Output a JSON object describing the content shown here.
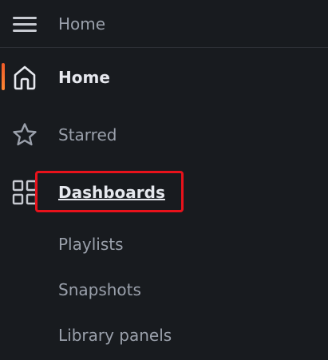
{
  "header": {
    "breadcrumb": "Home",
    "menu_icon": "hamburger-menu-icon"
  },
  "nav": {
    "items": [
      {
        "label": "Home",
        "icon": "home-icon",
        "active": true
      },
      {
        "label": "Starred",
        "icon": "star-icon",
        "active": false
      },
      {
        "label": "Dashboards",
        "icon": "grid-apps-icon",
        "active": false,
        "highlighted": true
      }
    ],
    "sub_items": [
      "Playlists",
      "Snapshots",
      "Library panels"
    ]
  },
  "colors": {
    "background": "#181b1f",
    "active_text": "#e6e8ee",
    "muted_text": "#9aa0ab",
    "active_indicator": "#f05a28",
    "highlight_border": "#e8121b"
  }
}
